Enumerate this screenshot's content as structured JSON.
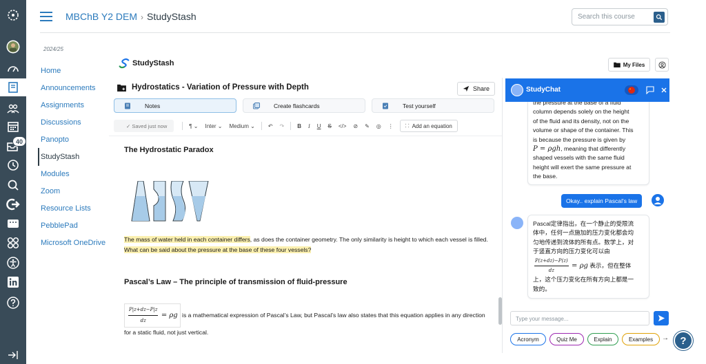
{
  "header": {
    "course": "MBChB Y2 DEM",
    "separator": "›",
    "page": "StudyStash",
    "search_placeholder": "Search this course"
  },
  "global_nav": {
    "badge": "40",
    "icons": [
      "canvas-logo-icon",
      "avatar-icon",
      "dashboard-icon",
      "courses-icon",
      "groups-icon",
      "calendar-icon",
      "inbox-icon",
      "history-icon",
      "search-icon",
      "logout-icon",
      "cohort-icon",
      "studio-icon",
      "accessibility-icon",
      "linkedin-icon",
      "help-icon",
      "collapse-icon"
    ]
  },
  "course_nav": {
    "term": "2024/25",
    "items": [
      {
        "label": "Home"
      },
      {
        "label": "Announcements"
      },
      {
        "label": "Assignments"
      },
      {
        "label": "Discussions"
      },
      {
        "label": "Panopto"
      },
      {
        "label": "StudyStash"
      },
      {
        "label": "Modules"
      },
      {
        "label": "Zoom"
      },
      {
        "label": "Resource Lists"
      },
      {
        "label": "PebblePad"
      },
      {
        "label": "Microsoft OneDrive"
      }
    ],
    "active_index": 5
  },
  "studystash": {
    "logo_text": "StudyStash",
    "my_files": "My Files"
  },
  "document": {
    "title": "Hydrostatics - Variation of Pressure with Depth",
    "share": "Share",
    "tabs": [
      {
        "label": "Notes"
      },
      {
        "label": "Create flashcards"
      },
      {
        "label": "Test yourself"
      }
    ],
    "toolbar": {
      "saved": "Saved just now",
      "paragraph": "¶",
      "font": "Inter",
      "size": "Medium",
      "add_equation": "Add an equation"
    },
    "section1_heading": "The Hydrostatic Paradox",
    "para1_highlight_a": "The mass of water held in each container differs",
    "para1_mid": ", as does the container geometry. The only similarity is height to which each vessel is filled. ",
    "para1_highlight_b": "What can be said about the pressure at the base of these four vessels?",
    "section2_heading": "Pascal’s Law – The principle of transmission of fluid-pressure",
    "para2_eq_num": "P|z+dz−P|z",
    "para2_eq_den": "dz",
    "para2_eq_rhs": "= ρg",
    "para2_text": " is a mathematical expression of Pascal’s Law, but Pascal’s law also states that this equation applies in any direction for a static fluid, not just vertical."
  },
  "chat": {
    "title": "StudyChat",
    "ai_msg1_lines": [
      "the pressure at the base of a fluid",
      "column depends solely on the height",
      "of the fluid and its density, not on the",
      "volume or shape of the container. This",
      "is because the pressure is given by"
    ],
    "ai_msg1_eq": "P = ρgh",
    "ai_msg1_after_eq": ", meaning that differently",
    "ai_msg1_tail_lines": [
      "shaped vessels with the same fluid",
      "height will exert the same pressure at",
      "the base."
    ],
    "user_msg": "Okay.. explain Pascal's law",
    "ai_msg2_lines": [
      "Pascal定律指出，在一个静止的受限流",
      "体中，任何一点施加的压力变化都会均",
      "匀地传递到流体的所有点。数学上，对",
      "于竖直方向的压力变化可以由"
    ],
    "ai_msg2_eq_num": "P(z+dz)−P(z)",
    "ai_msg2_eq_den": "dz",
    "ai_msg2_eq_rhs": "= ρg",
    "ai_msg2_after_eq": " 表示，但在整体",
    "ai_msg2_tail_lines": [
      "上，这个压力变化在所有方向上都是一",
      "致的。"
    ],
    "input_placeholder": "Type your message...",
    "chips": [
      {
        "label": "Acronym",
        "color": "#1a73e8"
      },
      {
        "label": "Quiz Me",
        "color": "#9c27b0"
      },
      {
        "label": "Explain",
        "color": "#2e9d4f"
      },
      {
        "label": "Examples",
        "color": "#e0a106"
      }
    ],
    "more_arrow": "→"
  },
  "help_button": "?"
}
